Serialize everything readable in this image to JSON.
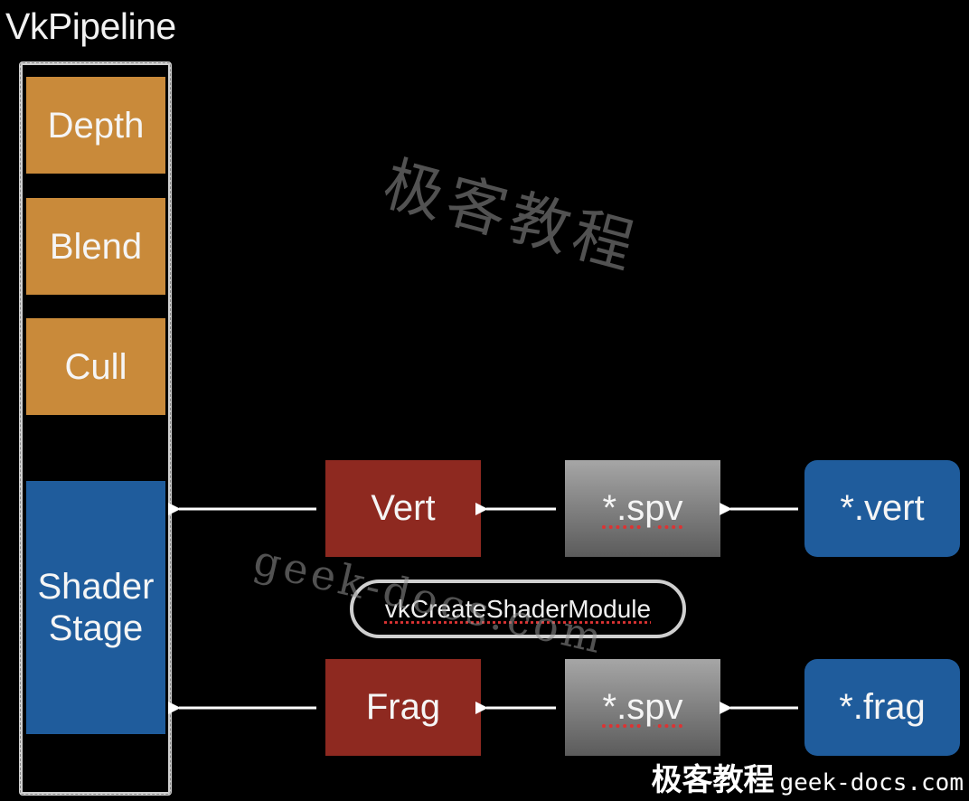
{
  "title": "VkPipeline",
  "pipeline": {
    "stages": [
      {
        "label": "Depth"
      },
      {
        "label": "Blend"
      },
      {
        "label": "Cull"
      },
      {
        "label": "Shader\nStage"
      }
    ]
  },
  "shaders": {
    "vert": {
      "module": "Vert",
      "binary": "*.spv",
      "source": "*.vert"
    },
    "frag": {
      "module": "Frag",
      "binary": "*.spv",
      "source": "*.frag"
    }
  },
  "create_call": "vkCreateShaderModule",
  "colors": {
    "fixed_stage": "#c98a3a",
    "shader_stage": "#1f5c9c",
    "module": "#8e2920",
    "binary": "#808080",
    "source": "#1f5c9c",
    "arrow": "#ffffff"
  },
  "watermark": {
    "cn": "极客教程",
    "url": "geek-docs.com",
    "footer_cn": "极客教程",
    "footer_url": "geek-docs.com"
  }
}
